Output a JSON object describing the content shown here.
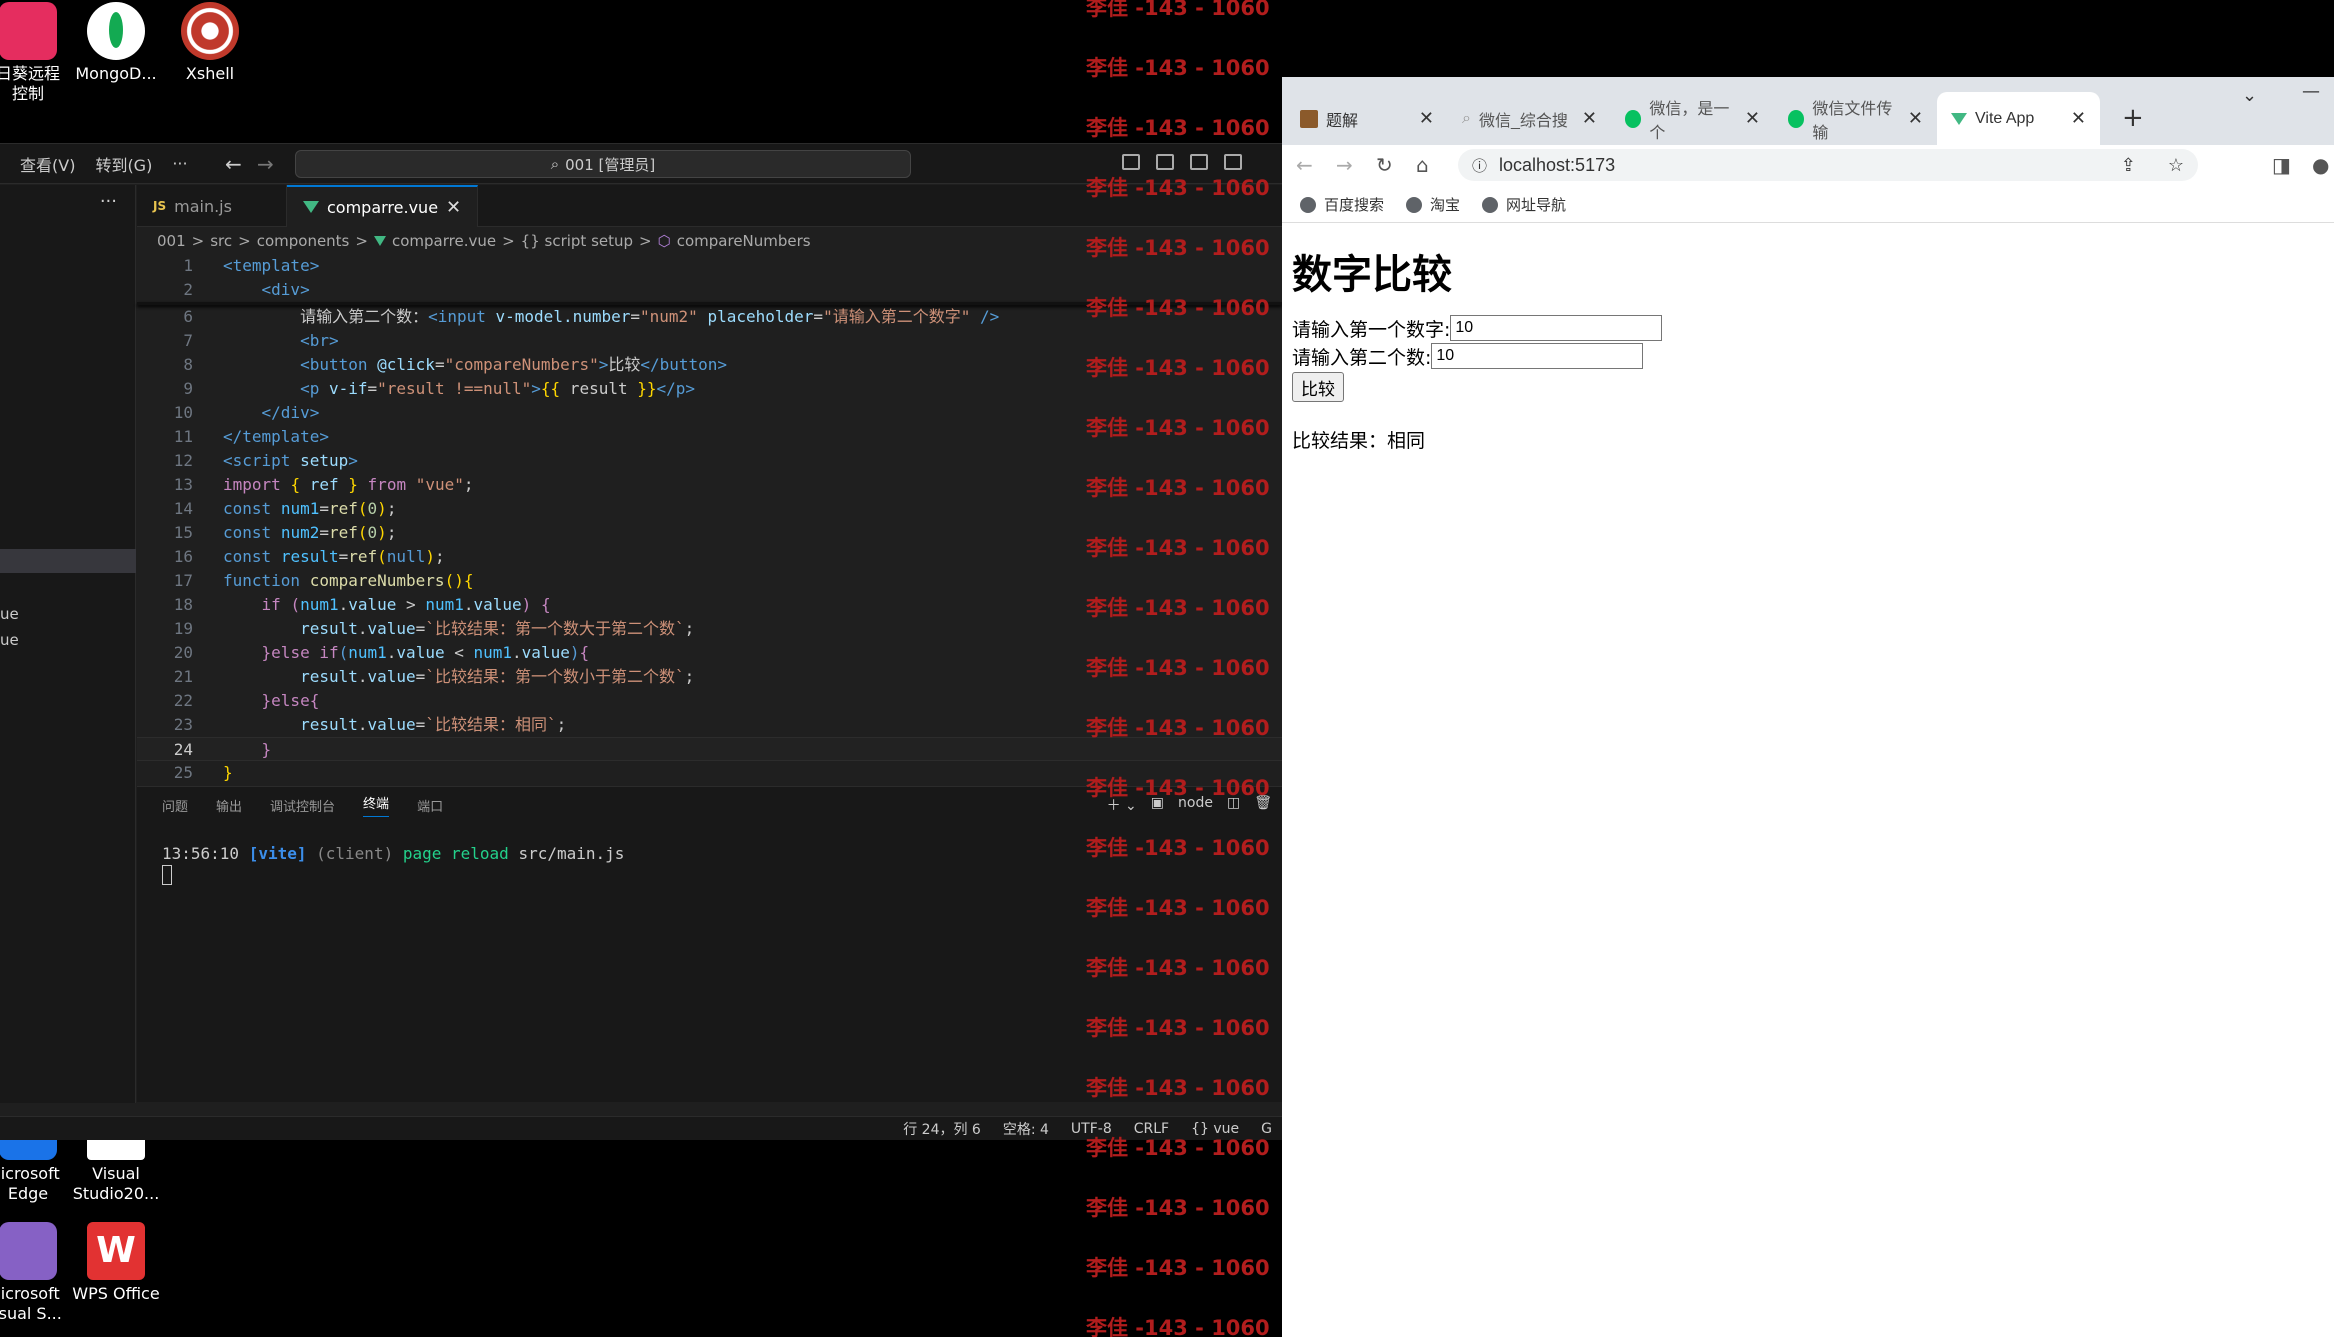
{
  "desktop": {
    "icons": [
      {
        "label": "日葵远程\n控制",
        "color": "#e52d5f"
      },
      {
        "label": "MongoD...",
        "color": "#ffffff"
      },
      {
        "label": "Xshell",
        "color": "#c0392b"
      },
      {
        "label": "licrosoft\nEdge",
        "color": "#1a73e8"
      },
      {
        "label": "Visual\nStudio20...",
        "color": "#ffffff"
      },
      {
        "label": "licrosoft\nisual S...",
        "color": "#8661c5"
      },
      {
        "label": "WPS Office",
        "color": "#e23232"
      }
    ],
    "watermark": "李佳 -143 - 1060"
  },
  "vscode": {
    "menu": [
      "查看(V)",
      "转到(G)",
      "···"
    ],
    "search": "001 [管理员]",
    "sidebar_frag1": "ue",
    "sidebar_frag2": "ue",
    "tabs": [
      {
        "label": "main.js"
      },
      {
        "label": "comparre.vue"
      }
    ],
    "breadcrumb": [
      "001",
      ">",
      "src",
      ">",
      "components",
      ">",
      "comparre.vue",
      ">",
      "{} script setup",
      ">",
      "compareNumbers"
    ],
    "panel_tabs": [
      "问题",
      "输出",
      "调试控制台",
      "终端",
      "端口"
    ],
    "panel_node": "node",
    "terminal_time": "13:56:10",
    "terminal_tag": "[vite]",
    "terminal_client": "(client)",
    "terminal_msg": "page reload",
    "terminal_file": "src/main.js",
    "status": [
      "行 24，列 6",
      "空格: 4",
      "UTF-8",
      "CRLF",
      "{} vue",
      "G"
    ]
  },
  "browser": {
    "tabs": [
      {
        "label": "题解",
        "color": "#8b5a2b"
      },
      {
        "label": "微信_综合搜",
        "color": "#999999"
      },
      {
        "label": "微信，是一个",
        "color": "#07c160"
      },
      {
        "label": "微信文件传输",
        "color": "#07c160"
      },
      {
        "label": "Vite App",
        "color": "#41b883"
      }
    ],
    "url": "localhost:5173",
    "bookmarks": [
      "百度搜索",
      "淘宝",
      "网址导航"
    ],
    "page": {
      "title": "数字比较",
      "label1": "请输入第一个数字:",
      "value1": "10",
      "label2": "请输入第二个数:",
      "value2": "10",
      "button": "比较",
      "result": "比较结果：相同"
    }
  }
}
